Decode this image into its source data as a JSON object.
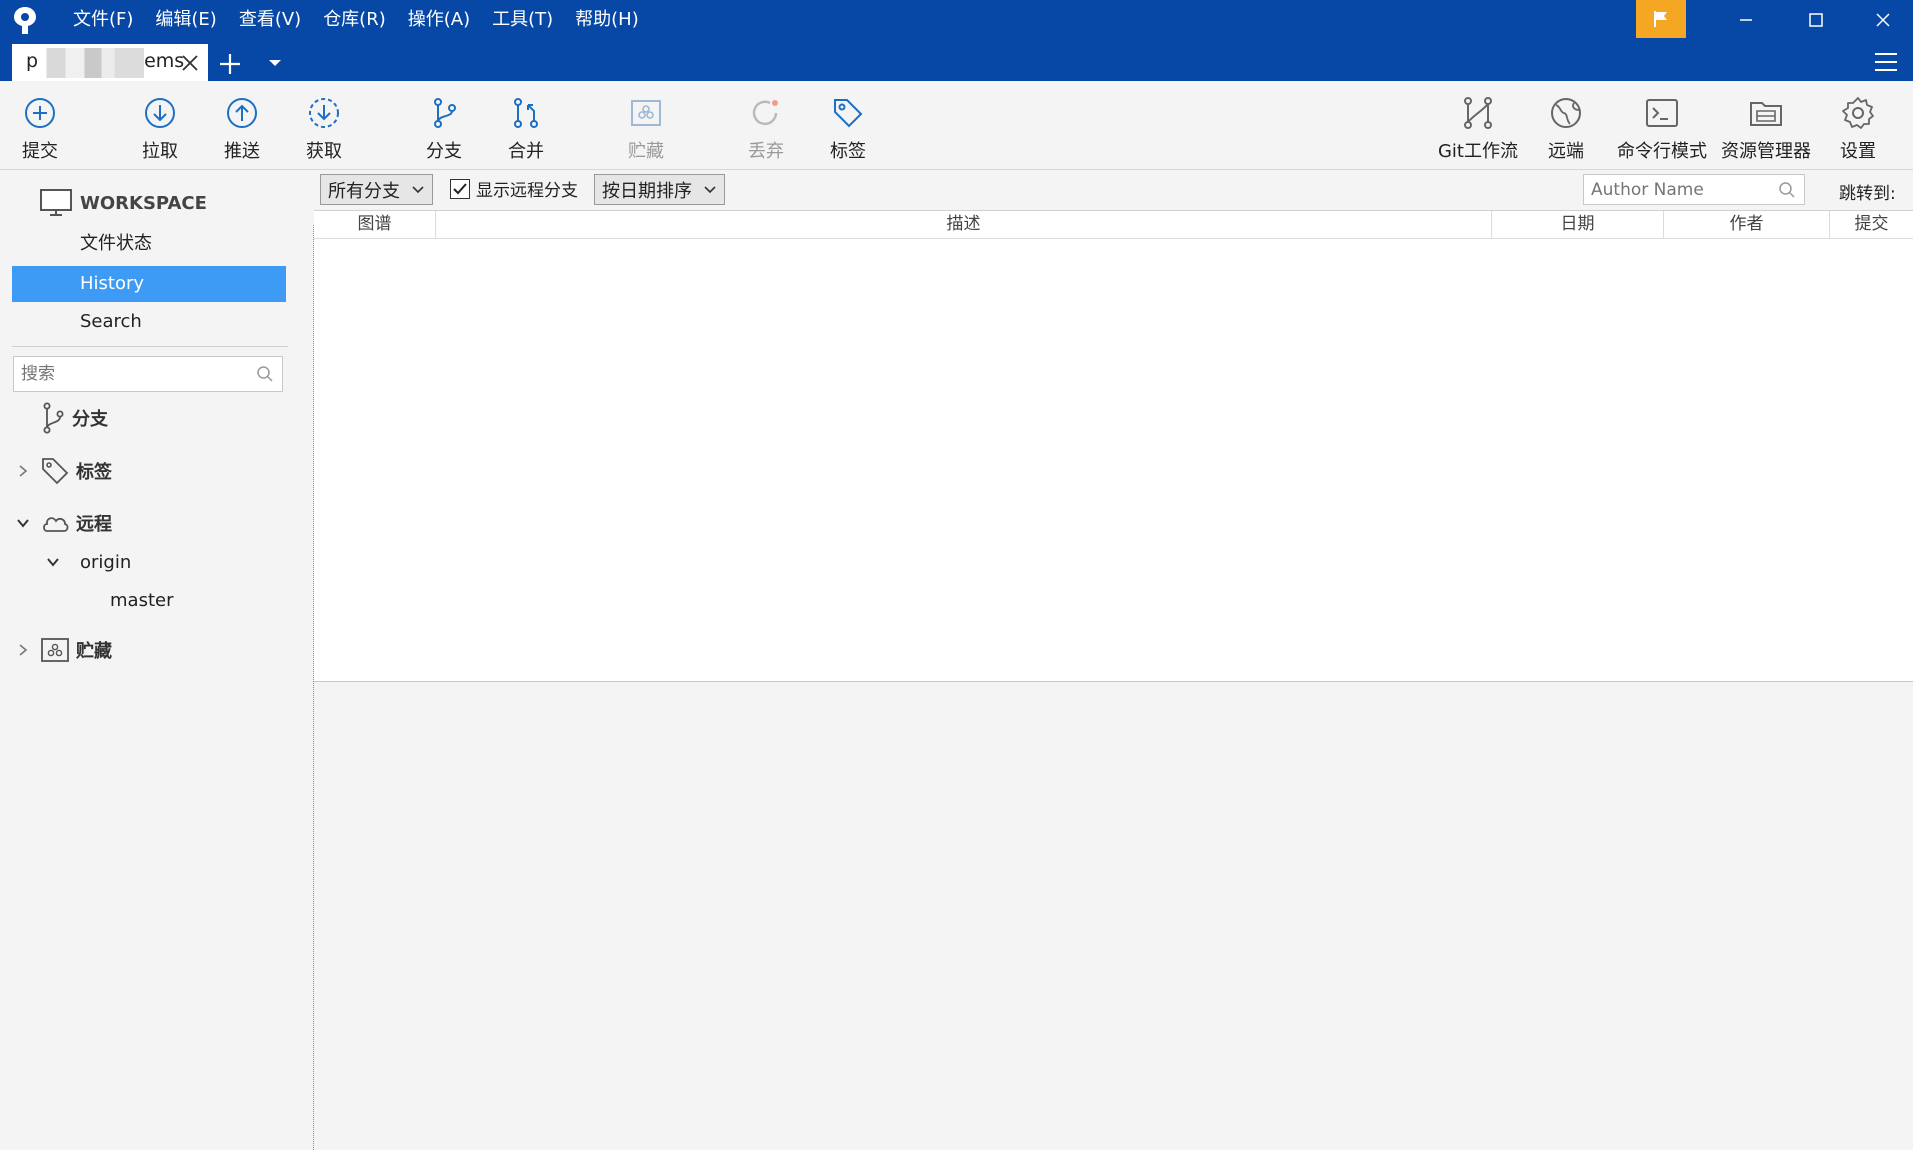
{
  "menu": [
    "文件(F)",
    "编辑(E)",
    "查看(V)",
    "仓库(R)",
    "操作(A)",
    "工具(T)",
    "帮助(H)"
  ],
  "tab": {
    "title_start": "p",
    "title_end": "ems"
  },
  "toolbar": {
    "commit": "提交",
    "pull": "拉取",
    "push": "推送",
    "fetch": "获取",
    "branch": "分支",
    "merge": "合并",
    "stash": "贮藏",
    "discard": "丢弃",
    "tag": "标签",
    "git_flow": "Git工作流",
    "remote": "远端",
    "terminal": "命令行模式",
    "explorer": "资源管理器",
    "settings": "设置"
  },
  "sidebar": {
    "workspace_label": "WORKSPACE",
    "workspace_items": {
      "file_status": "文件状态",
      "history": "History",
      "search": "Search"
    },
    "search_placeholder": "搜索",
    "tree": {
      "branches": "分支",
      "tags": "标签",
      "remotes": "远程",
      "origin": "origin",
      "master": "master",
      "stashes": "贮藏"
    }
  },
  "filters": {
    "branch_filter": "所有分支",
    "show_remote_branches": "显示远程分支",
    "show_remote_checked": true,
    "sort_order": "按日期排序",
    "author_placeholder": "Author Name",
    "jump_to": "跳转到:"
  },
  "history_table": {
    "columns": [
      "图谱",
      "描述",
      "日期",
      "作者",
      "提交"
    ],
    "rows": []
  },
  "colors": {
    "titlebar": "#0747a6",
    "selected": "#3d9bf5",
    "flag": "#f5a623",
    "icon": "#1c6fc4"
  }
}
